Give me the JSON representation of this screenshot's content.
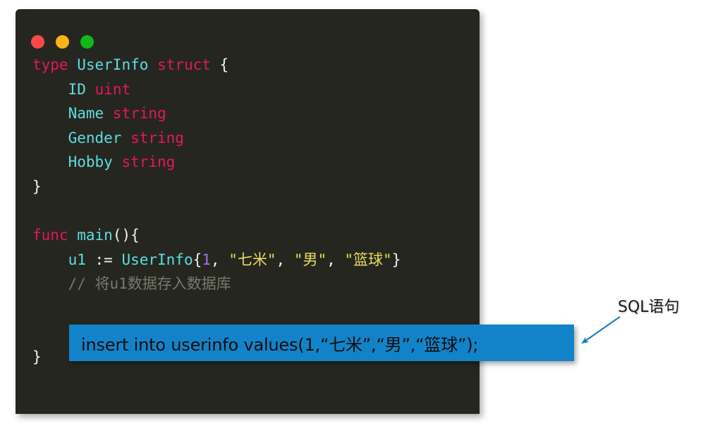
{
  "window": {
    "title_dots": [
      {
        "name": "close",
        "color": "#fc4a47"
      },
      {
        "name": "minimize",
        "color": "#fdb515"
      },
      {
        "name": "maximize",
        "color": "#10b91b"
      }
    ],
    "background": "#262621"
  },
  "code": {
    "language": "go",
    "lines": [
      {
        "id": "line-1",
        "tokens": [
          {
            "t": "type",
            "c": "kw"
          },
          {
            "t": " ",
            "c": "plain"
          },
          {
            "t": "UserInfo",
            "c": "type"
          },
          {
            "t": " ",
            "c": "plain"
          },
          {
            "t": "struct",
            "c": "kw"
          },
          {
            "t": " {",
            "c": "punct"
          }
        ]
      },
      {
        "id": "line-2",
        "tokens": [
          {
            "t": "    ",
            "c": "plain"
          },
          {
            "t": "ID",
            "c": "ident"
          },
          {
            "t": " ",
            "c": "plain"
          },
          {
            "t": "uint",
            "c": "kw"
          }
        ]
      },
      {
        "id": "line-3",
        "tokens": [
          {
            "t": "    ",
            "c": "plain"
          },
          {
            "t": "Name",
            "c": "ident"
          },
          {
            "t": " ",
            "c": "plain"
          },
          {
            "t": "string",
            "c": "kw"
          }
        ]
      },
      {
        "id": "line-4",
        "tokens": [
          {
            "t": "    ",
            "c": "plain"
          },
          {
            "t": "Gender",
            "c": "ident"
          },
          {
            "t": " ",
            "c": "plain"
          },
          {
            "t": "string",
            "c": "kw"
          }
        ]
      },
      {
        "id": "line-5",
        "tokens": [
          {
            "t": "    ",
            "c": "plain"
          },
          {
            "t": "Hobby",
            "c": "ident"
          },
          {
            "t": " ",
            "c": "plain"
          },
          {
            "t": "string",
            "c": "kw"
          }
        ]
      },
      {
        "id": "line-6",
        "tokens": [
          {
            "t": "}",
            "c": "punct"
          }
        ]
      },
      {
        "id": "line-7",
        "tokens": []
      },
      {
        "id": "line-8",
        "tokens": [
          {
            "t": "func",
            "c": "kw"
          },
          {
            "t": " ",
            "c": "plain"
          },
          {
            "t": "main",
            "c": "func"
          },
          {
            "t": "(){",
            "c": "punct"
          }
        ]
      },
      {
        "id": "line-9",
        "tokens": [
          {
            "t": "    ",
            "c": "plain"
          },
          {
            "t": "u1",
            "c": "ident"
          },
          {
            "t": " := ",
            "c": "punct"
          },
          {
            "t": "UserInfo",
            "c": "type"
          },
          {
            "t": "{",
            "c": "punct"
          },
          {
            "t": "1",
            "c": "num"
          },
          {
            "t": ", ",
            "c": "punct"
          },
          {
            "t": "\"七米\"",
            "c": "str"
          },
          {
            "t": ", ",
            "c": "punct"
          },
          {
            "t": "\"男\"",
            "c": "str"
          },
          {
            "t": ", ",
            "c": "punct"
          },
          {
            "t": "\"篮球\"",
            "c": "str"
          },
          {
            "t": "}",
            "c": "punct"
          }
        ]
      },
      {
        "id": "line-10",
        "tokens": [
          {
            "t": "    ",
            "c": "plain"
          },
          {
            "t": "// 将u1数据存入数据库",
            "c": "comment"
          }
        ]
      },
      {
        "id": "line-11",
        "tokens": []
      },
      {
        "id": "line-12",
        "tokens": []
      },
      {
        "id": "line-13",
        "tokens": [
          {
            "t": "}",
            "c": "punct"
          }
        ]
      }
    ]
  },
  "sql_highlight": {
    "statement": "insert into userinfo values(1,“七米”,“男”,“篮球”);",
    "background": "#1283c8",
    "text_color": "#0d0d0d"
  },
  "annotation": {
    "label": "SQL语句",
    "arrow_color": "#1c7cc0",
    "points_to": "sql_highlight"
  }
}
